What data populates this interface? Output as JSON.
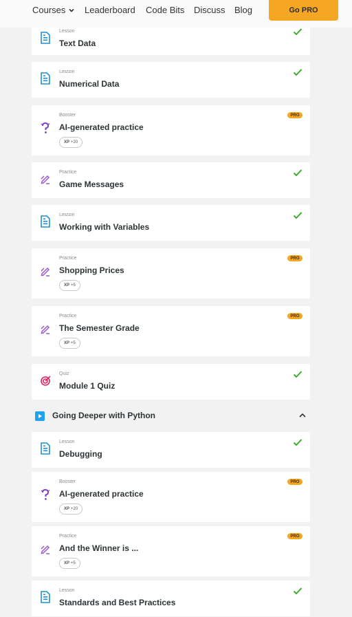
{
  "header": {
    "nav": [
      "Courses",
      "Leaderboard",
      "Code Bits",
      "Discuss",
      "Blog"
    ],
    "cta": "Go PRO"
  },
  "section": {
    "title": "Going Deeper with Python"
  },
  "lessons": [
    {
      "type": "Lesson",
      "title": "Text Data",
      "status": "done",
      "kind": "lesson"
    },
    {
      "type": "Lesson",
      "title": "Numerical Data",
      "status": "done",
      "kind": "lesson"
    },
    {
      "type": "Booster",
      "title": "AI-generated practice",
      "status": "pro",
      "kind": "booster",
      "xp_label": "XP",
      "xp_value": "+20"
    },
    {
      "type": "Practice",
      "title": "Game Messages",
      "status": "done",
      "kind": "practice"
    },
    {
      "type": "Lesson",
      "title": "Working with Variables",
      "status": "done",
      "kind": "lesson"
    },
    {
      "type": "Practice",
      "title": "Shopping Prices",
      "status": "pro",
      "kind": "practice",
      "xp_label": "XP",
      "xp_value": "+5"
    },
    {
      "type": "Practice",
      "title": "The Semester Grade",
      "status": "pro",
      "kind": "practice",
      "xp_label": "XP",
      "xp_value": "+5"
    },
    {
      "type": "Quiz",
      "title": "Module 1 Quiz",
      "status": "done",
      "kind": "quiz"
    },
    {
      "type": "Lesson",
      "title": "Debugging",
      "status": "done",
      "kind": "lesson"
    },
    {
      "type": "Booster",
      "title": "AI-generated practice",
      "status": "pro",
      "kind": "booster",
      "xp_label": "XP",
      "xp_value": "+20"
    },
    {
      "type": "Practice",
      "title": "And the Winner is ...",
      "status": "pro",
      "kind": "practice",
      "xp_label": "XP",
      "xp_value": "+5"
    },
    {
      "type": "Lesson",
      "title": "Standards and Best Practices",
      "status": "done",
      "kind": "lesson"
    }
  ],
  "pro_badge": "PRO",
  "colors": {
    "lesson_icon": "#1f8fd6",
    "practice_icon": "#9b59d0",
    "booster_icon": "#7e3fc4",
    "quiz_icon": "#e0245e",
    "check": "#3daa2e",
    "pro": "#f5a623",
    "section_icon": "#1fa3f0"
  }
}
